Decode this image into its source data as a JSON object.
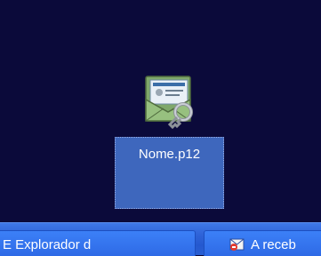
{
  "desktop": {
    "icon": {
      "label": "Nome.p12",
      "icon": "certificate-envelope-key-icon"
    }
  },
  "taskbar": {
    "buttons": [
      {
        "label": "E Explorador d",
        "icon": "explorer-icon"
      },
      {
        "label": "A receb",
        "icon": "outlook-inbox-icon"
      }
    ]
  }
}
